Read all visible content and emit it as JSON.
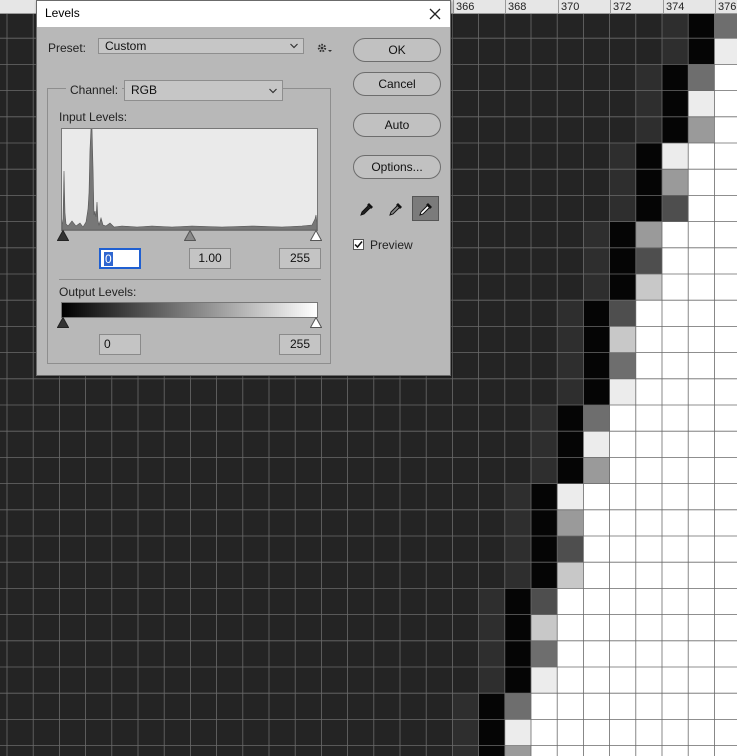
{
  "ruler": {
    "labels": [
      "366",
      "368",
      "370",
      "372",
      "374",
      "376"
    ]
  },
  "dialog": {
    "title": "Levels",
    "preset_label": "Preset:",
    "preset_value": "Custom",
    "channel_label": "Channel:",
    "channel_value": "RGB",
    "input_levels_label": "Input Levels:",
    "input_black": "0",
    "input_gamma": "1.00",
    "input_white": "255",
    "output_levels_label": "Output Levels:",
    "output_black": "0",
    "output_white": "255",
    "buttons": {
      "ok": "OK",
      "cancel": "Cancel",
      "auto": "Auto",
      "options": "Options..."
    },
    "preview_label": "Preview",
    "preview_checked": true
  },
  "icons": {
    "close": "close-icon",
    "gear": "gear-icon",
    "chevron": "chevron-down-icon",
    "black_point": "eyedropper-black-icon",
    "gray_point": "eyedropper-gray-icon",
    "white_point": "eyedropper-white-icon"
  }
}
